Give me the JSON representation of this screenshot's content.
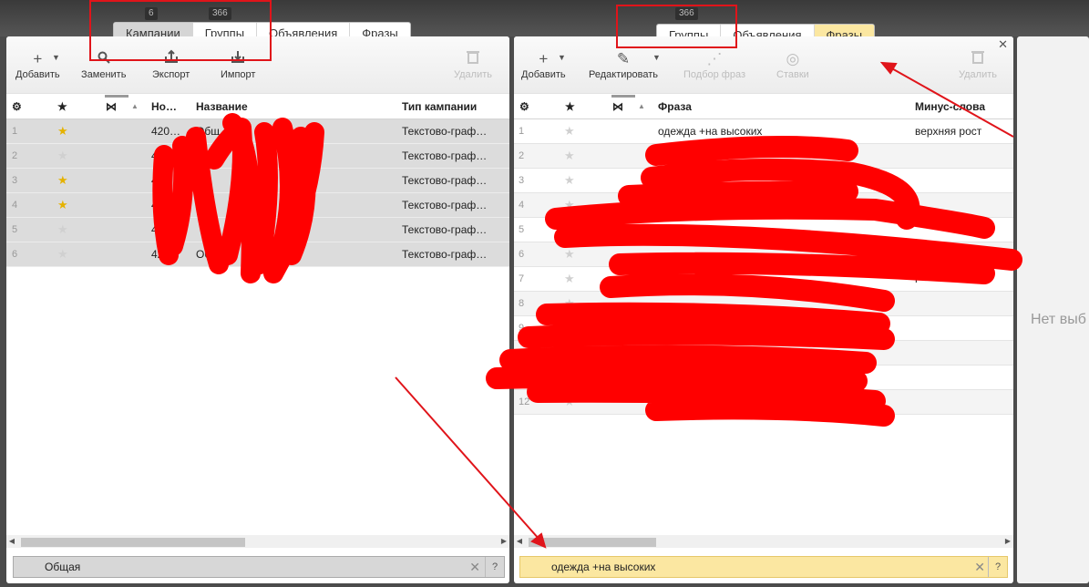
{
  "left": {
    "tab_count_1": "6",
    "tab_count_2": "366",
    "tabs": [
      "Кампании",
      "Группы",
      "Объявления",
      "Фразы"
    ],
    "toolbar": {
      "add": "Добавить",
      "replace": "Заменить",
      "export": "Экспорт",
      "import": "Импорт",
      "delete": "Удалить"
    },
    "columns": {
      "number": "Но…",
      "name": "Название",
      "type": "Тип кампании"
    },
    "rows": [
      {
        "n": "1",
        "fav": true,
        "number": "420…",
        "name": "Общ",
        "name_tail": "П",
        "type": "Текстово-граф…"
      },
      {
        "n": "2",
        "fav": false,
        "number": "4",
        "name": "",
        "name_tail": "",
        "type": "Текстово-граф…"
      },
      {
        "n": "3",
        "fav": true,
        "number": "4",
        "name": "",
        "name_tail": "",
        "type": "Текстово-граф…"
      },
      {
        "n": "4",
        "fav": true,
        "number": "4",
        "name": "",
        "name_tail": "",
        "type": "Текстово-граф…"
      },
      {
        "n": "5",
        "fav": false,
        "number": "4",
        "name": "",
        "name_tail": "а П",
        "type": "Текстово-граф…"
      },
      {
        "n": "6",
        "fav": false,
        "number": "42",
        "name": "Общая",
        "name_tail": "",
        "type": "Текстово-граф…"
      }
    ],
    "filter": "Общая",
    "help": "?"
  },
  "right": {
    "tab_count": "366",
    "tabs": [
      "Группы",
      "Объявления",
      "Фразы"
    ],
    "toolbar": {
      "add": "Добавить",
      "edit": "Редактировать",
      "pick": "Подбор фраз",
      "bids": "Ставки",
      "delete": "Удалить"
    },
    "columns": {
      "phrase": "Фраза",
      "minus": "Минус-слова"
    },
    "rows": [
      {
        "n": "1",
        "phrase": "одежда +на высоких",
        "minus": "верхняя рост"
      },
      {
        "n": "2",
        "phrase": "",
        "minus": ""
      },
      {
        "n": "3",
        "phrase": "",
        "minus": ""
      },
      {
        "n": "4",
        "phrase": "",
        "minus": ""
      },
      {
        "n": "5",
        "phrase": "",
        "minus": ""
      },
      {
        "n": "6",
        "phrase": "",
        "minus": ""
      },
      {
        "n": "7",
        "phrase": "",
        "minus": "г"
      },
      {
        "n": "8",
        "phrase": "",
        "minus": ""
      },
      {
        "n": "9",
        "phrase": "",
        "minus": ""
      },
      {
        "n": "10",
        "phrase": "",
        "minus": ""
      },
      {
        "n": "11",
        "phrase": "",
        "minus": ""
      },
      {
        "n": "12",
        "phrase": "",
        "minus": ""
      }
    ],
    "filter": "одежда +на высоких",
    "help": "?"
  },
  "third": {
    "placeholder": "Нет выб"
  },
  "colors": {
    "annotation_red": "#e0141a",
    "favorite_star": "#e5b200",
    "active_tab_yellow": "#fbe7a1"
  }
}
